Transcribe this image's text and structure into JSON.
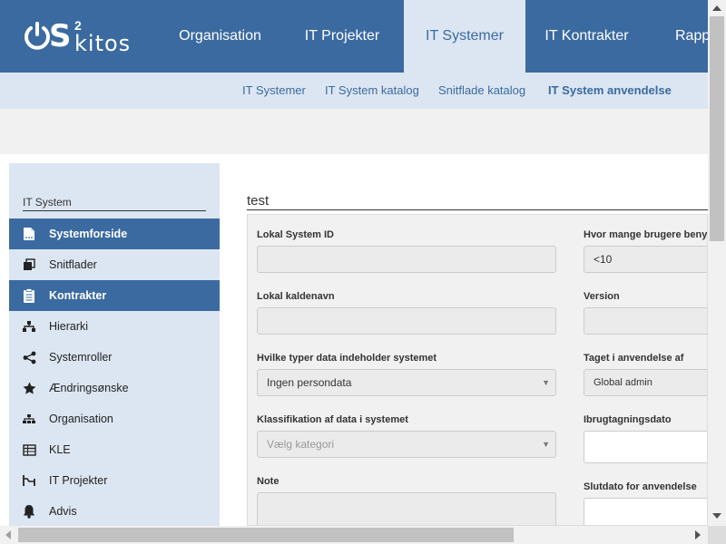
{
  "logo": {
    "os": "OS",
    "sup": "2",
    "kitos": "kitos"
  },
  "topnav": {
    "items": [
      {
        "label": "Organisation"
      },
      {
        "label": "IT Projekter"
      },
      {
        "label": "IT Systemer"
      },
      {
        "label": "IT Kontrakter"
      },
      {
        "label": "Rapp"
      }
    ],
    "active": "IT Systemer"
  },
  "subnav": {
    "items": [
      {
        "label": "IT Systemer"
      },
      {
        "label": "IT System katalog"
      },
      {
        "label": "Snitflade katalog"
      },
      {
        "label": "IT System anvendelse"
      }
    ],
    "active": "IT System anvendelse"
  },
  "sidebar": {
    "title": "IT System",
    "items": [
      {
        "label": "Systemforside",
        "icon": "document-icon"
      },
      {
        "label": "Snitflader",
        "icon": "window-icon"
      },
      {
        "label": "Kontrakter",
        "icon": "clipboard-icon"
      },
      {
        "label": "Hierarki",
        "icon": "sitemap-icon"
      },
      {
        "label": "Systemroller",
        "icon": "share-icon"
      },
      {
        "label": "Ændringsønske",
        "icon": "star-icon"
      },
      {
        "label": "Organisation",
        "icon": "org-icon"
      },
      {
        "label": "KLE",
        "icon": "table-icon"
      },
      {
        "label": "IT Projekter",
        "icon": "project-icon"
      },
      {
        "label": "Advis",
        "icon": "bell-icon"
      }
    ]
  },
  "main": {
    "title": "test",
    "left": {
      "local_id_label": "Lokal System ID",
      "local_id_value": "",
      "local_name_label": "Lokal kaldenavn",
      "local_name_value": "",
      "data_types_label": "Hvilke typer data indeholder systemet",
      "data_types_value": "Ingen persondata",
      "classification_label": "Klassifikation af data i systemet",
      "classification_placeholder": "Vælg kategori",
      "note_label": "Note",
      "note_value": ""
    },
    "right": {
      "users_label": "Hvor mange brugere benytt",
      "users_value": "<10",
      "version_label": "Version",
      "version_value": "",
      "taken_by_label": "Taget i anvendelse af",
      "taken_by_value": "Global admin",
      "start_date_label": "Ibrugtagningsdato",
      "start_date_value": "",
      "end_date_label": "Slutdato for anvendelse",
      "end_date_value": ""
    }
  },
  "colors": {
    "brand": "#3b6aa0",
    "light": "#dce6f2",
    "panel": "#f1f1f1"
  }
}
